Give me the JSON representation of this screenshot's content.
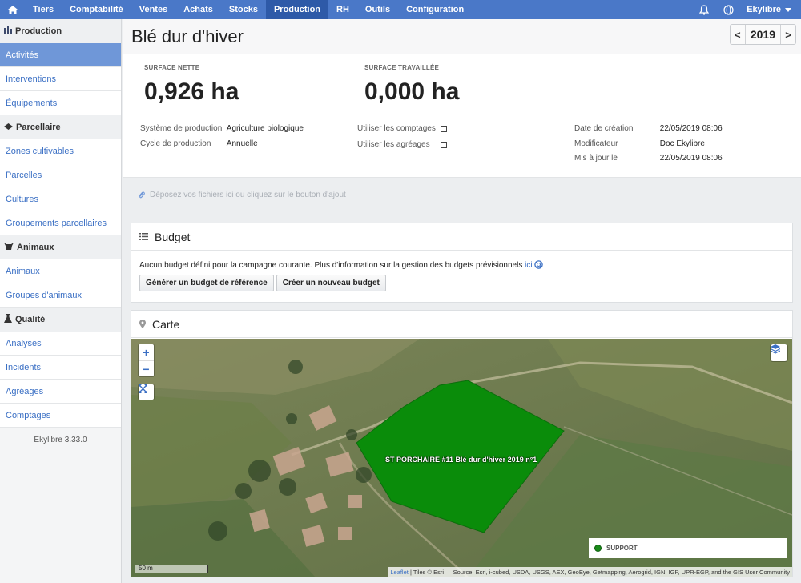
{
  "nav": {
    "items": [
      "Tiers",
      "Comptabilité",
      "Ventes",
      "Achats",
      "Stocks",
      "Production",
      "RH",
      "Outils",
      "Configuration"
    ],
    "active": "Production",
    "user": "Ekylibre",
    "icons": [
      "home-icon",
      "bell-icon",
      "globe-icon",
      "caret-down-icon"
    ]
  },
  "sidebar": {
    "sections": [
      {
        "title": "Production",
        "icon": "production-icon",
        "items": [
          "Activités",
          "Interventions",
          "Équipements"
        ]
      },
      {
        "title": "Parcellaire",
        "icon": "parcel-icon",
        "items": [
          "Zones cultivables",
          "Parcelles",
          "Cultures",
          "Groupements parcellaires"
        ]
      },
      {
        "title": "Animaux",
        "icon": "cow-icon",
        "items": [
          "Animaux",
          "Groupes d'animaux"
        ]
      },
      {
        "title": "Qualité",
        "icon": "flask-icon",
        "items": [
          "Analyses",
          "Incidents",
          "Agréages",
          "Comptages"
        ]
      }
    ],
    "active_item": "Activités",
    "version": "Ekylibre 3.33.0"
  },
  "page": {
    "title": "Blé dur d'hiver",
    "year": "2019",
    "prev_label": "<",
    "next_label": ">"
  },
  "summary": {
    "net_surface_label": "SURFACE NETTE",
    "net_surface_value": "0,926 ha",
    "worked_surface_label": "SURFACE TRAVAILLÉE",
    "worked_surface_value": "0,000 ha",
    "production_system_label": "Système de production",
    "production_system_value": "Agriculture biologique",
    "production_cycle_label": "Cycle de production",
    "production_cycle_value": "Annuelle",
    "use_counts_label": "Utiliser les comptages",
    "use_counts_checked": false,
    "use_gradings_label": "Utiliser les agréages",
    "use_gradings_checked": false,
    "created_label": "Date de création",
    "created_value": "22/05/2019 08:06",
    "modifier_label": "Modificateur",
    "modifier_value": "Doc Ekylibre",
    "updated_label": "Mis à jour le",
    "updated_value": "22/05/2019 08:06"
  },
  "dropzone": {
    "text": "Déposez vos fichiers ici ou cliquez sur le bouton d'ajout"
  },
  "budget": {
    "title": "Budget",
    "message": "Aucun budget défini pour la campagne courante. Plus d'information sur la gestion des budgets prévisionnels",
    "link_text": "ici",
    "generate_button": "Générer un budget de référence",
    "create_button": "Créer un nouveau budget"
  },
  "map": {
    "title": "Carte",
    "zoom_in": "+",
    "zoom_out": "−",
    "field_label": "ST PORCHAIRE #11 Blé dur d'hiver 2019 n°1",
    "field_color": "#0a8c0a",
    "legend_label": "SUPPORT",
    "scale_label": "50 m",
    "attribution_link": "Leaflet",
    "attribution_text": " | Tiles © Esri — Source: Esri, i-cubed, USDA, USGS, AEX, GeoEye, Getmapping, Aerogrid, IGN, IGP, UPR-EGP, and the GIS User Community"
  },
  "colors": {
    "nav_bg": "#4a78c8",
    "nav_active": "#2e5aa8",
    "sidebar_active": "#6f97d8",
    "link": "#3a6fc4"
  }
}
